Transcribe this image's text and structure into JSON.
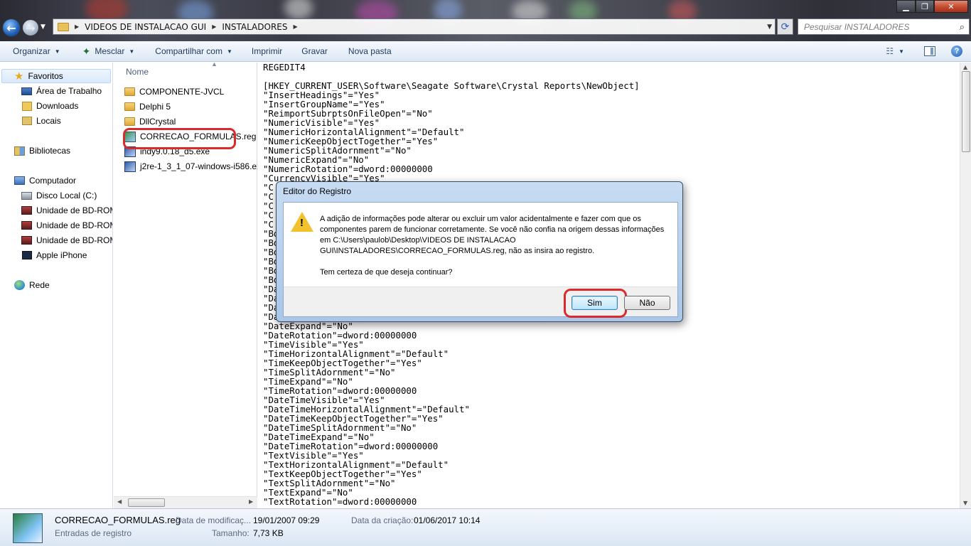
{
  "window": {
    "address": [
      "VIDEOS DE INSTALACAO GUI",
      "INSTALADORES"
    ],
    "search_placeholder": "Pesquisar INSTALADORES"
  },
  "toolbar": {
    "organize": "Organizar",
    "mix": "Mesclar",
    "share": "Compartilhar com",
    "print": "Imprimir",
    "burn": "Gravar",
    "new_folder": "Nova pasta"
  },
  "nav": {
    "favorites": "Favoritos",
    "desktop": "Área de Trabalho",
    "downloads": "Downloads",
    "places": "Locais",
    "libraries": "Bibliotecas",
    "computer": "Computador",
    "local_disk": "Disco Local (C:)",
    "bd_rom_1": "Unidade de BD-ROM",
    "bd_rom_2": "Unidade de BD-ROM",
    "bd_rom_3": "Unidade de BD-ROM",
    "iphone": "Apple iPhone",
    "network": "Rede"
  },
  "files": {
    "column_name": "Nome",
    "items": [
      "COMPONENTE-JVCL",
      "Delphi 5",
      "DllCrystal",
      "CORRECAO_FORMULAS.reg",
      "indy9.0.18_d5.exe",
      "j2re-1_3_1_07-windows-i586.exe"
    ]
  },
  "preview": {
    "lines": [
      "REGEDIT4",
      "",
      "[HKEY_CURRENT_USER\\Software\\Seagate Software\\Crystal Reports\\NewObject]",
      "\"InsertHeadings\"=\"Yes\"",
      "\"InsertGroupName\"=\"Yes\"",
      "\"ReimportSubrptsOnFileOpen\"=\"No\"",
      "\"NumericVisible\"=\"Yes\"",
      "\"NumericHorizontalAlignment\"=\"Default\"",
      "\"NumericKeepObjectTogether\"=\"Yes\"",
      "\"NumericSplitAdornment\"=\"No\"",
      "\"NumericExpand\"=\"No\"",
      "\"NumericRotation\"=dword:00000000",
      "\"CurrencyVisible\"=\"Yes\"",
      "\"C",
      "\"C",
      "\"C",
      "\"C",
      "\"C",
      "\"Bo",
      "\"Bo",
      "\"Bo",
      "\"Bo",
      "\"Bo",
      "\"Bo",
      "\"Da",
      "\"Da",
      "\"Da",
      "\"Da",
      "\"DateExpand\"=\"No\"",
      "\"DateRotation\"=dword:00000000",
      "\"TimeVisible\"=\"Yes\"",
      "\"TimeHorizontalAlignment\"=\"Default\"",
      "\"TimeKeepObjectTogether\"=\"Yes\"",
      "\"TimeSplitAdornment\"=\"No\"",
      "\"TimeExpand\"=\"No\"",
      "\"TimeRotation\"=dword:00000000",
      "\"DateTimeVisible\"=\"Yes\"",
      "\"DateTimeHorizontalAlignment\"=\"Default\"",
      "\"DateTimeKeepObjectTogether\"=\"Yes\"",
      "\"DateTimeSplitAdornment\"=\"No\"",
      "\"DateTimeExpand\"=\"No\"",
      "\"DateTimeRotation\"=dword:00000000",
      "\"TextVisible\"=\"Yes\"",
      "\"TextHorizontalAlignment\"=\"Default\"",
      "\"TextKeepObjectTogether\"=\"Yes\"",
      "\"TextSplitAdornment\"=\"No\"",
      "\"TextExpand\"=\"No\"",
      "\"TextRotation\"=dword:00000000"
    ]
  },
  "details": {
    "file_name": "CORRECAO_FORMULAS.reg",
    "file_type": "Entradas de registro",
    "modified_label": "Data de modificaç...",
    "modified_value": "19/01/2007 09:29",
    "size_label": "Tamanho:",
    "size_value": "7,73 KB",
    "created_label": "Data da criação:",
    "created_value": "01/06/2017 10:14"
  },
  "dialog": {
    "title": "Editor do Registro",
    "message": "A adição de informações pode alterar ou excluir um valor acidentalmente e fazer com que os componentes parem de funcionar corretamente. Se você não confia na origem dessas informações em C:\\Users\\paulob\\Desktop\\VIDEOS DE INSTALACAO GUI\\INSTALADORES\\CORRECAO_FORMULAS.reg, não as insira ao registro.",
    "question": "Tem certeza de que deseja continuar?",
    "yes": "Sim",
    "no": "Não"
  },
  "colors": {
    "highlight": "#d92b2b",
    "toolbar_text": "#1e395b",
    "dialog_frame": "#a9c6e8"
  }
}
